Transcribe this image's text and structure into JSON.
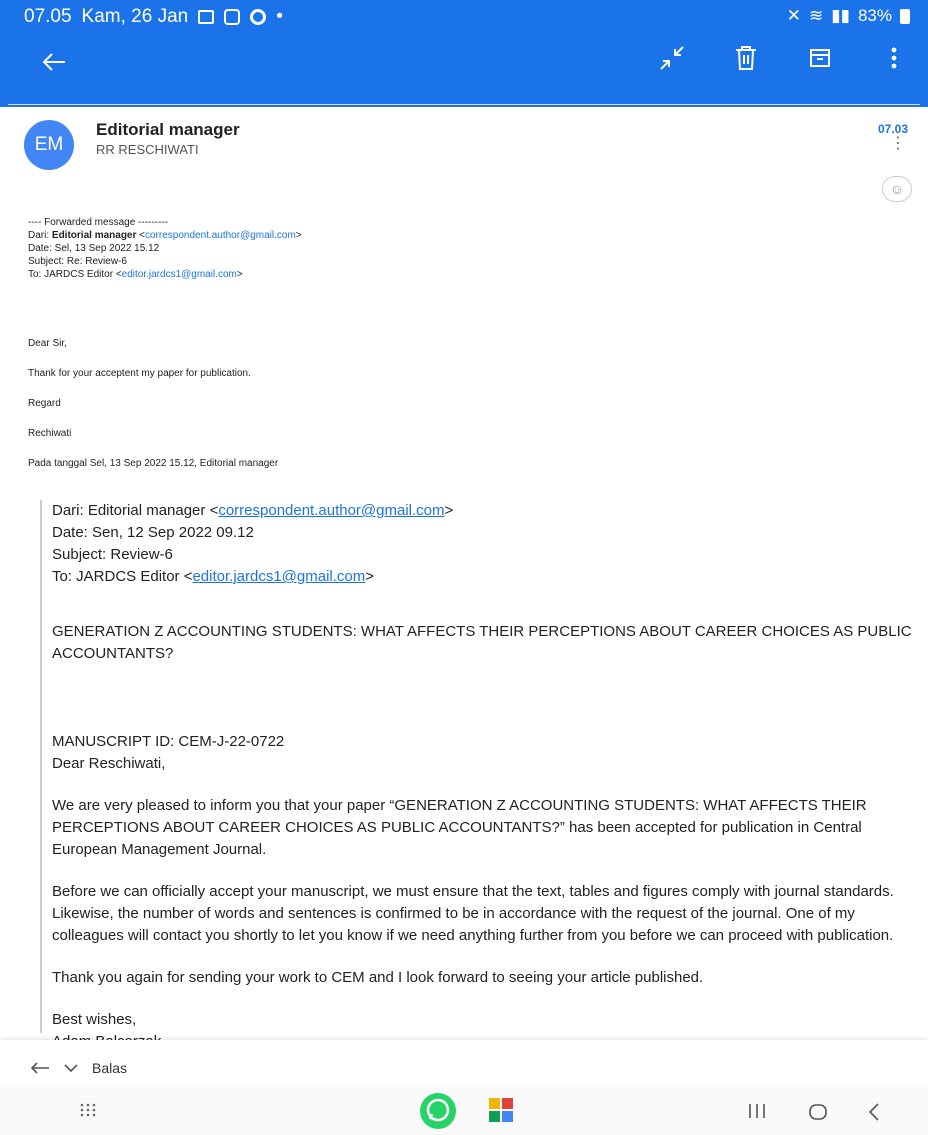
{
  "status_bar": {
    "time": "07.05",
    "date": "Kam, 26 Jan",
    "battery": "83%"
  },
  "header": {
    "avatar_initials": "EM",
    "sender": "Editorial manager",
    "recipient": "RR RESCHIWATI",
    "time": "07.03"
  },
  "forwarded": {
    "title": "---- Forwarded message ---------",
    "from_label": "Dari: ",
    "from_name": "Editorial manager",
    "from_email": "correspondent.author@gmail.com",
    "date": "Date: Sel, 13 Sep 2022 15.12",
    "subject": "Subject: Re: Review-6",
    "to_label": "To: JARDCS Editor <",
    "to_email": "editor.jardcs1@gmail.com"
  },
  "body": {
    "greeting": "Dear Sir,",
    "line1": "Thank for your acceptent my paper for publication.",
    "regards": "Regard",
    "name": "Rechiwati",
    "pada": "Pada tanggal  Sel, 13 Sep 2022 15.12, Editorial manager"
  },
  "quoted": {
    "from_label": "Dari: Editorial manager <",
    "from_email": "correspondent.author@gmail.com",
    "date": "Date: Sen, 12 Sep 2022 09.12",
    "subject": "Subject: Review-6",
    "to_label": "To: JARDCS Editor <",
    "to_email": "editor.jardcs1@gmail.com",
    "title": "GENERATION Z ACCOUNTING STUDENTS: WHAT AFFECTS THEIR PERCEPTIONS ABOUT CAREER CHOICES AS PUBLIC ACCOUNTANTS?",
    "manuscript_id": "MANUSCRIPT ID: CEM-J-22-0722",
    "dear": "Dear Reschiwati,",
    "para1": "We are very pleased to inform you that your paper “GENERATION Z ACCOUNTING STUDENTS: WHAT AFFECTS THEIR PERCEPTIONS ABOUT CAREER CHOICES AS PUBLIC ACCOUNTANTS?” has been accepted for publication in Central European Management Journal.",
    "para2": "Before we can officially accept your manuscript, we must ensure that the text, tables and figures comply with journal standards.  Likewise, the number of words and sentences is confirmed to be in accordance with the request of the journal.  One of my colleagues will contact you shortly to let you know if we need anything further from you before we can proceed with publication.",
    "para3": "Thank you again for sending your work to CEM and I look forward to seeing your article published.",
    "closing": "Best wishes,",
    "signature": "Adam Balcerzak"
  },
  "reply": {
    "label": "Balas"
  },
  "icons": {
    "back": "arrow-left-icon",
    "collapse": "collapse-icon",
    "delete": "trash-icon",
    "archive": "archive-icon",
    "more": "more-vert-icon"
  },
  "colors": {
    "primary": "#1a73e8",
    "avatar": "#4285f4"
  }
}
